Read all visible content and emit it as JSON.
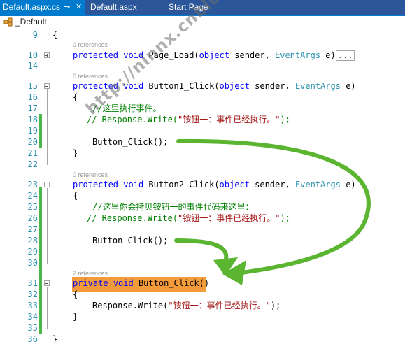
{
  "tabs": [
    {
      "label": "Default.aspx.cs",
      "active": true,
      "pin_icon": "pin-icon",
      "close_icon": "close-icon"
    },
    {
      "label": "Default.aspx",
      "active": false
    },
    {
      "label": "Start Page",
      "active": false
    }
  ],
  "navbar": {
    "class_icon": "class-icon",
    "class_name": "_Default"
  },
  "editor": {
    "line_numbers": [
      "9",
      "10",
      "14",
      "15",
      "16",
      "17",
      "18",
      "19",
      "20",
      "21",
      "22",
      "23",
      "24",
      "25",
      "26",
      "27",
      "28",
      "29",
      "30",
      "31",
      "32",
      "33",
      "34",
      "35",
      "36"
    ],
    "codelens": [
      "0 references",
      "0 references",
      "0 references",
      "2 references"
    ],
    "lines": {
      "l9": "{",
      "l10_kw": "protected",
      "l10_void": "void",
      "l10_name": " Page_Load(",
      "l10_obj": "object",
      "l10_sender": " sender, ",
      "l10_ea": "EventArgs",
      "l10_e": " e)",
      "l10_collapsed": "...",
      "l15_kw": "protected",
      "l15_void": "void",
      "l15_name": " Button1_Click(",
      "l15_obj": "object",
      "l15_sender": " sender, ",
      "l15_ea": "EventArgs",
      "l15_e": " e)",
      "l16": "{",
      "l17_comment": "//这里执行事件。",
      "l18_comment": "// Response.Write(",
      "l18_str": "\"铵钮一：事件已经执行。\"",
      "l18_end": ");",
      "l20": "Button_Click();",
      "l21": "}",
      "l23_kw": "protected",
      "l23_void": "void",
      "l23_name": " Button2_Click(",
      "l23_obj": "object",
      "l23_sender": " sender, ",
      "l23_ea": "EventArgs",
      "l23_e": " e)",
      "l24": "{",
      "l25_comment": "//这里你会拷贝铵钮一的事件代码来这里：",
      "l26_comment": "// Response.Write(",
      "l26_str": "\"铵钮一：事件已经执行。\"",
      "l26_end": ");",
      "l28": "Button_Click();",
      "l31_kw": "private",
      "l31_void": "void",
      "l31_name": " Button_Click()",
      "l32": "{",
      "l33_call": "Response.Write(",
      "l33_str": "\"铵钮一：事件已经执行。\"",
      "l33_end": ");",
      "l34": "}",
      "l36": "}"
    }
  },
  "watermark": "http://ninnx.cnblogs.com",
  "colors": {
    "tab_bar": "#2b579a",
    "active_tab": "#007acc",
    "keyword": "#0000ff",
    "type": "#2b91af",
    "string": "#a31515",
    "comment": "#008000",
    "line_number": "#2b91af",
    "change_bar": "#4cb84c",
    "highlight": "#f39a3a",
    "arrow": "#5bb531"
  }
}
